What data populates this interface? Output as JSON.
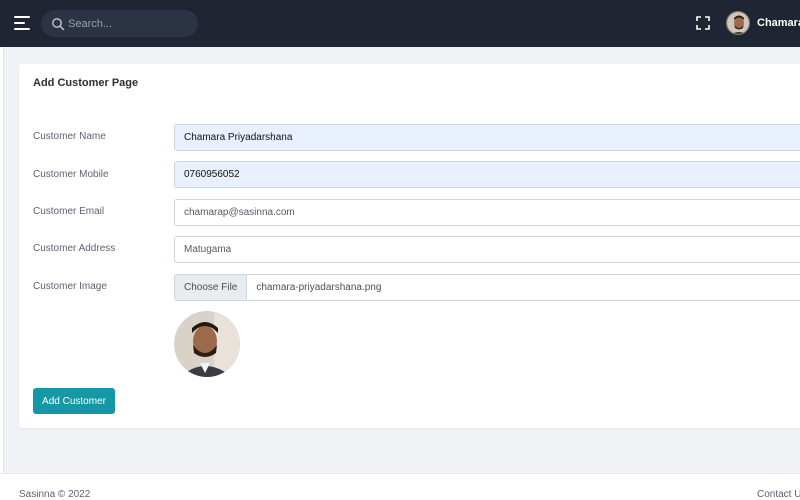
{
  "header": {
    "search_placeholder": "Search...",
    "user_name": "Chamara P"
  },
  "card": {
    "title": "Add Customer Page"
  },
  "form": {
    "name": {
      "label": "Customer Name",
      "value": "Chamara Priyadarshana"
    },
    "mobile": {
      "label": "Customer Mobile",
      "value": "0760956052"
    },
    "email": {
      "label": "Customer Email",
      "value": "chamarap@sasinna.com"
    },
    "address": {
      "label": "Customer Address",
      "value": "Matugama"
    },
    "image": {
      "label": "Customer Image",
      "button_label": "Choose File",
      "file_name": "chamara-priyadarshana.png"
    },
    "submit_label": "Add Customer"
  },
  "footer": {
    "copyright": "Sasinna © 2022",
    "contact_label": "Contact U"
  },
  "colors": {
    "topbar": "#1f2533",
    "accent": "#1598a6",
    "autofill": "#e8f0fe"
  },
  "icons": [
    "menu-icon",
    "search-icon",
    "fullscreen-icon"
  ]
}
